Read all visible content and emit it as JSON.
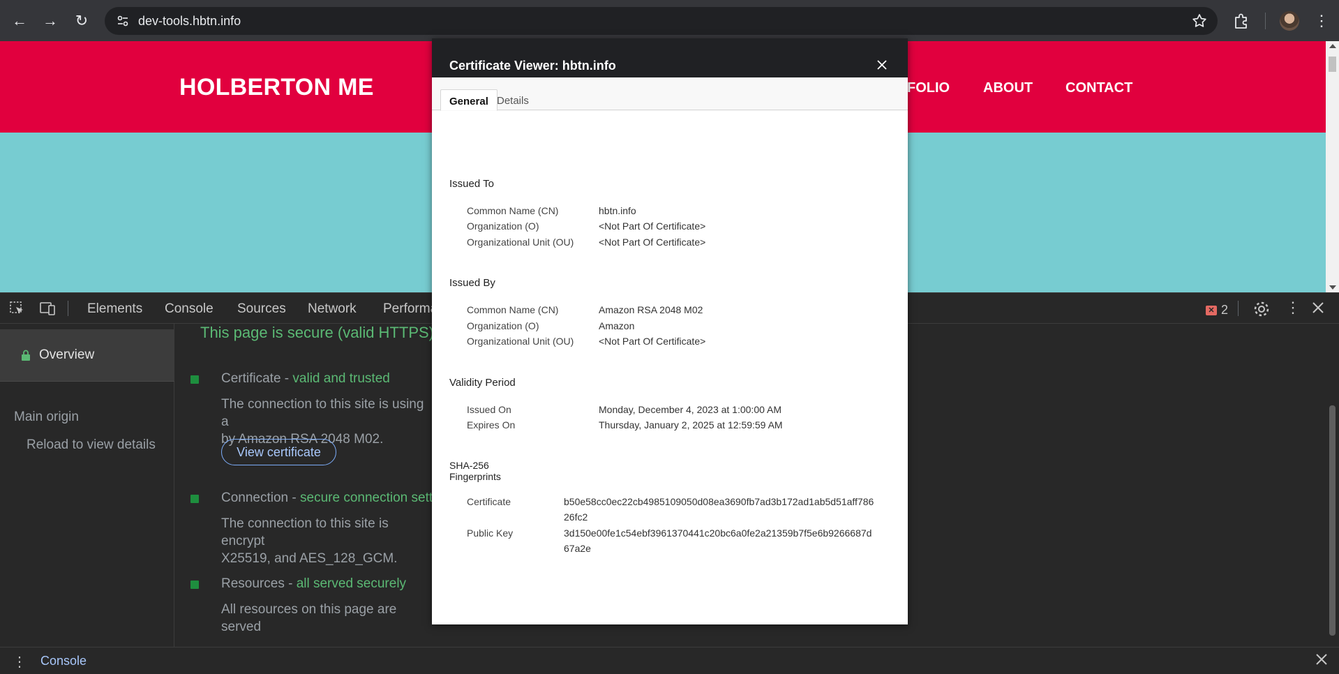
{
  "browser": {
    "url": "dev-tools.hbtn.info",
    "back_icon": "←",
    "forward_icon": "→",
    "reload_icon": "↻",
    "menu_icon": "⋮"
  },
  "site": {
    "logo": "HOLBERTON ME",
    "nav": [
      "FOLIO",
      "ABOUT",
      "CONTACT"
    ],
    "header_color": "#e1003e",
    "hero_color": "#77ccd1"
  },
  "devtools": {
    "tabs": [
      "Elements",
      "Console",
      "Sources",
      "Network",
      "Performa"
    ],
    "error_count": "2",
    "sidebar": {
      "overview": "Overview",
      "main_origin": "Main origin",
      "reload": "Reload to view details"
    },
    "summary": "This page is secure (valid HTTPS).",
    "certificate": {
      "title_prefix": "Certificate - ",
      "title_status": "valid and trusted",
      "desc_line1": "The connection to this site is using a",
      "desc_line2": "by Amazon RSA 2048 M02.",
      "button": "View certificate"
    },
    "connection": {
      "title_prefix": "Connection - ",
      "title_status": "secure connection setti",
      "desc_line1": "The connection to this site is encrypt",
      "desc_line2": "X25519, and AES_128_GCM."
    },
    "resources": {
      "title_prefix": "Resources - ",
      "title_status": "all served securely",
      "desc": "All resources on this page are served"
    },
    "drawer_label": "Console"
  },
  "cert_viewer": {
    "title": "Certificate Viewer: hbtn.info",
    "tabs": {
      "general": "General",
      "details": "Details"
    },
    "issued_to": {
      "heading": "Issued To",
      "cn_label": "Common Name (CN)",
      "cn": "hbtn.info",
      "o_label": "Organization (O)",
      "o": "<Not Part Of Certificate>",
      "ou_label": "Organizational Unit (OU)",
      "ou": "<Not Part Of Certificate>"
    },
    "issued_by": {
      "heading": "Issued By",
      "cn_label": "Common Name (CN)",
      "cn": "Amazon RSA 2048 M02",
      "o_label": "Organization (O)",
      "o": "Amazon",
      "ou_label": "Organizational Unit (OU)",
      "ou": "<Not Part Of Certificate>"
    },
    "validity": {
      "heading": "Validity Period",
      "issued_label": "Issued On",
      "issued": "Monday, December 4, 2023 at 1:00:00 AM",
      "expires_label": "Expires On",
      "expires": "Thursday, January 2, 2025 at 12:59:59 AM"
    },
    "fingerprints": {
      "heading_line1": "SHA-256",
      "heading_line2": "Fingerprints",
      "cert_label": "Certificate",
      "cert_line1": "b50e58cc0ec22cb4985109050d08ea3690fb7ad3b172ad1ab5d51aff786",
      "cert_line2": "26fc2",
      "pk_label": "Public Key",
      "pk_line1": "3d150e00fe1c54ebf3961370441c20bc6a0fe2a21359b7f5e6b9266687d",
      "pk_line2": "67a2e"
    }
  }
}
